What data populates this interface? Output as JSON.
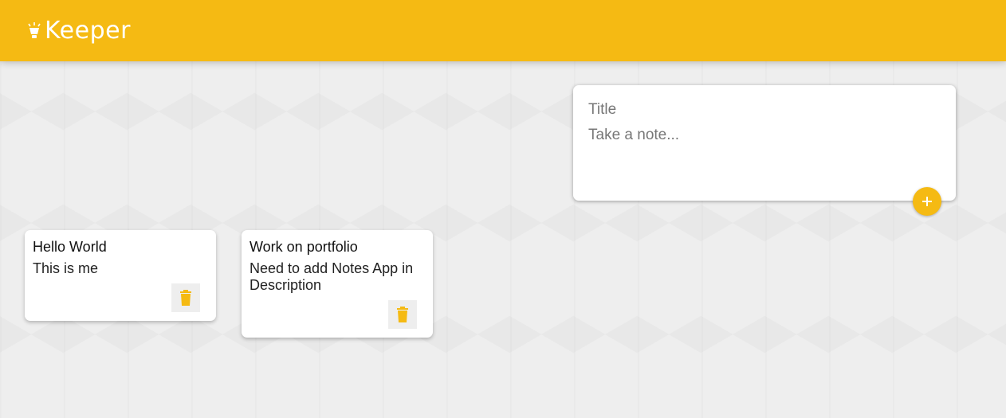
{
  "header": {
    "logo_text": "Keeper",
    "brand_color": "#f5ba13"
  },
  "create_note": {
    "title_placeholder": "Title",
    "content_placeholder": "Take a note...",
    "add_icon": "plus-icon"
  },
  "notes": [
    {
      "title": "Hello World",
      "content": "This is me",
      "delete_icon": "trash-icon"
    },
    {
      "title": "Work on portfolio",
      "content": "Need to add Notes App in Description",
      "delete_icon": "trash-icon"
    }
  ]
}
